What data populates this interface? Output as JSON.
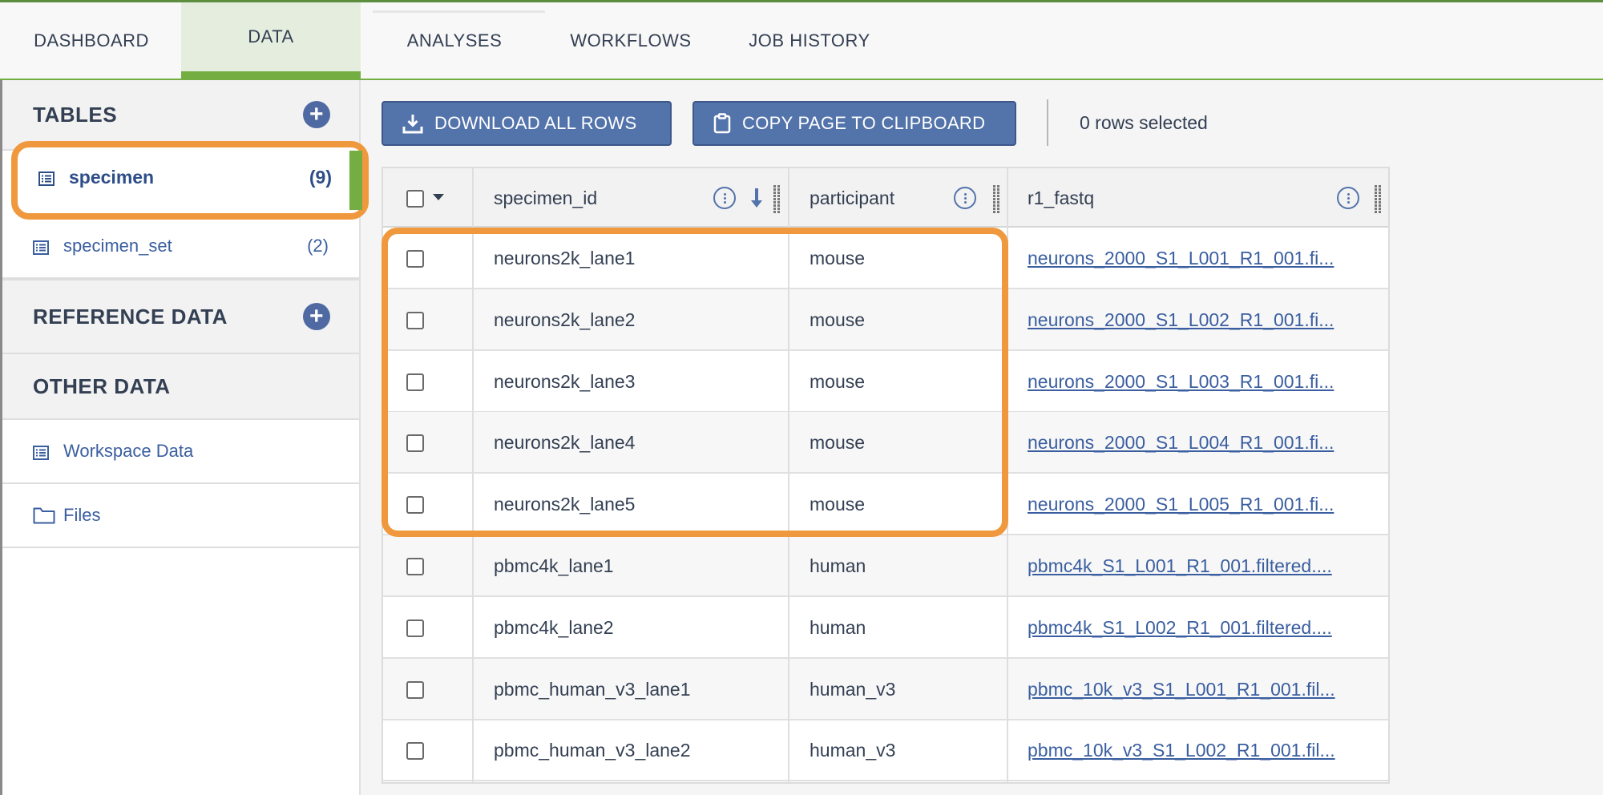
{
  "nav": {
    "tabs": [
      {
        "label": "DASHBOARD"
      },
      {
        "label": "DATA"
      },
      {
        "label": "ANALYSES"
      },
      {
        "label": "WORKFLOWS"
      },
      {
        "label": "JOB HISTORY"
      }
    ],
    "active": "DATA"
  },
  "sidebar": {
    "tables_header": "TABLES",
    "tables": [
      {
        "label": "specimen",
        "count": "(9)",
        "selected": true
      },
      {
        "label": "specimen_set",
        "count": "(2)"
      }
    ],
    "reference_header": "REFERENCE DATA",
    "other_header": "OTHER DATA",
    "other_items": [
      {
        "label": "Workspace Data",
        "icon": "table-icon"
      },
      {
        "label": "Files",
        "icon": "folder-icon"
      }
    ]
  },
  "toolbar": {
    "download_label": "DOWNLOAD ALL ROWS",
    "copy_label": "COPY PAGE TO CLIPBOARD",
    "rows_selected": "0 rows selected"
  },
  "table": {
    "columns": [
      "specimen_id",
      "participant",
      "r1_fastq"
    ],
    "sorted_column": "specimen_id",
    "sort_direction": "descending",
    "rows": [
      {
        "specimen_id": "neurons2k_lane1",
        "participant": "mouse",
        "r1_fastq": "neurons_2000_S1_L001_R1_001.fi..."
      },
      {
        "specimen_id": "neurons2k_lane2",
        "participant": "mouse",
        "r1_fastq": "neurons_2000_S1_L002_R1_001.fi..."
      },
      {
        "specimen_id": "neurons2k_lane3",
        "participant": "mouse",
        "r1_fastq": "neurons_2000_S1_L003_R1_001.fi..."
      },
      {
        "specimen_id": "neurons2k_lane4",
        "participant": "mouse",
        "r1_fastq": "neurons_2000_S1_L004_R1_001.fi..."
      },
      {
        "specimen_id": "neurons2k_lane5",
        "participant": "mouse",
        "r1_fastq": "neurons_2000_S1_L005_R1_001.fi..."
      },
      {
        "specimen_id": "pbmc4k_lane1",
        "participant": "human",
        "r1_fastq": "pbmc4k_S1_L001_R1_001.filtered...."
      },
      {
        "specimen_id": "pbmc4k_lane2",
        "participant": "human",
        "r1_fastq": "pbmc4k_S1_L002_R1_001.filtered...."
      },
      {
        "specimen_id": "pbmc_human_v3_lane1",
        "participant": "human_v3",
        "r1_fastq": "pbmc_10k_v3_S1_L001_R1_001.fil..."
      },
      {
        "specimen_id": "pbmc_human_v3_lane2",
        "participant": "human_v3",
        "r1_fastq": "pbmc_10k_v3_S1_L002_R1_001.fil..."
      }
    ]
  },
  "colors": {
    "accent_green": "#74ae43",
    "button_blue": "#5373ab",
    "link_blue": "#3a5ea0",
    "highlight_orange": "#f0983d"
  }
}
